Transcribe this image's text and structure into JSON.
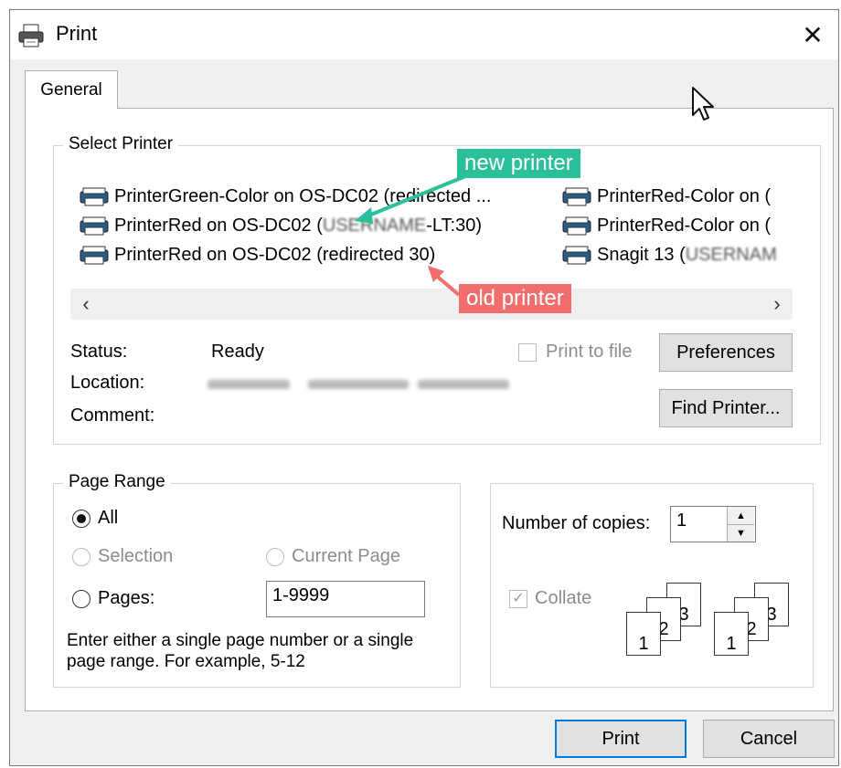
{
  "window": {
    "title": "Print",
    "close_glyph": "✕"
  },
  "tabs": [
    {
      "label": "General"
    }
  ],
  "select_printer": {
    "legend": "Select Printer",
    "printers": [
      {
        "name": "PrinterGreen-Color on OS-DC02 (redirected ...",
        "icon": "printer-icon"
      },
      {
        "name_prefix": "PrinterRed on OS-DC02 (",
        "name_blurred": "USERNAME",
        "name_suffix": "-LT:30)",
        "icon": "printer-icon"
      },
      {
        "name": "PrinterRed on OS-DC02 (redirected 30)",
        "icon": "printer-icon"
      },
      {
        "name": "PrinterRed-Color on (",
        "icon": "printer-icon"
      },
      {
        "name": "PrinterRed-Color on (",
        "icon": "printer-icon"
      },
      {
        "name_prefix": "Snagit 13 (",
        "name_blurred": "USERNAM",
        "icon": "printer-icon"
      }
    ],
    "scroll_left": "‹",
    "scroll_right": "›",
    "status_label": "Status:",
    "status_value": "Ready",
    "location_label": "Location:",
    "comment_label": "Comment:",
    "print_to_file_label": "Print to file",
    "preferences_label": "Preferences",
    "find_printer_label": "Find Printer..."
  },
  "annotations": {
    "new_printer": {
      "text": "new printer",
      "color": "#2bbf9a"
    },
    "old_printer": {
      "text": "old printer",
      "color": "#f26d6d"
    }
  },
  "page_range": {
    "legend": "Page Range",
    "all_label": "All",
    "selection_label": "Selection",
    "current_page_label": "Current Page",
    "pages_label": "Pages:",
    "pages_value": "1-9999",
    "hint": "Enter either a single page number or a single page range.  For example, 5-12"
  },
  "copies": {
    "number_label": "Number of copies:",
    "number_value": "1",
    "collate_label": "Collate",
    "collate_pages": [
      "1",
      "2",
      "3"
    ]
  },
  "footer": {
    "print_label": "Print",
    "cancel_label": "Cancel"
  },
  "colors": {
    "accent": "#0078d7",
    "new_arrow": "#2bbf9a",
    "old_arrow": "#f26d6d"
  }
}
